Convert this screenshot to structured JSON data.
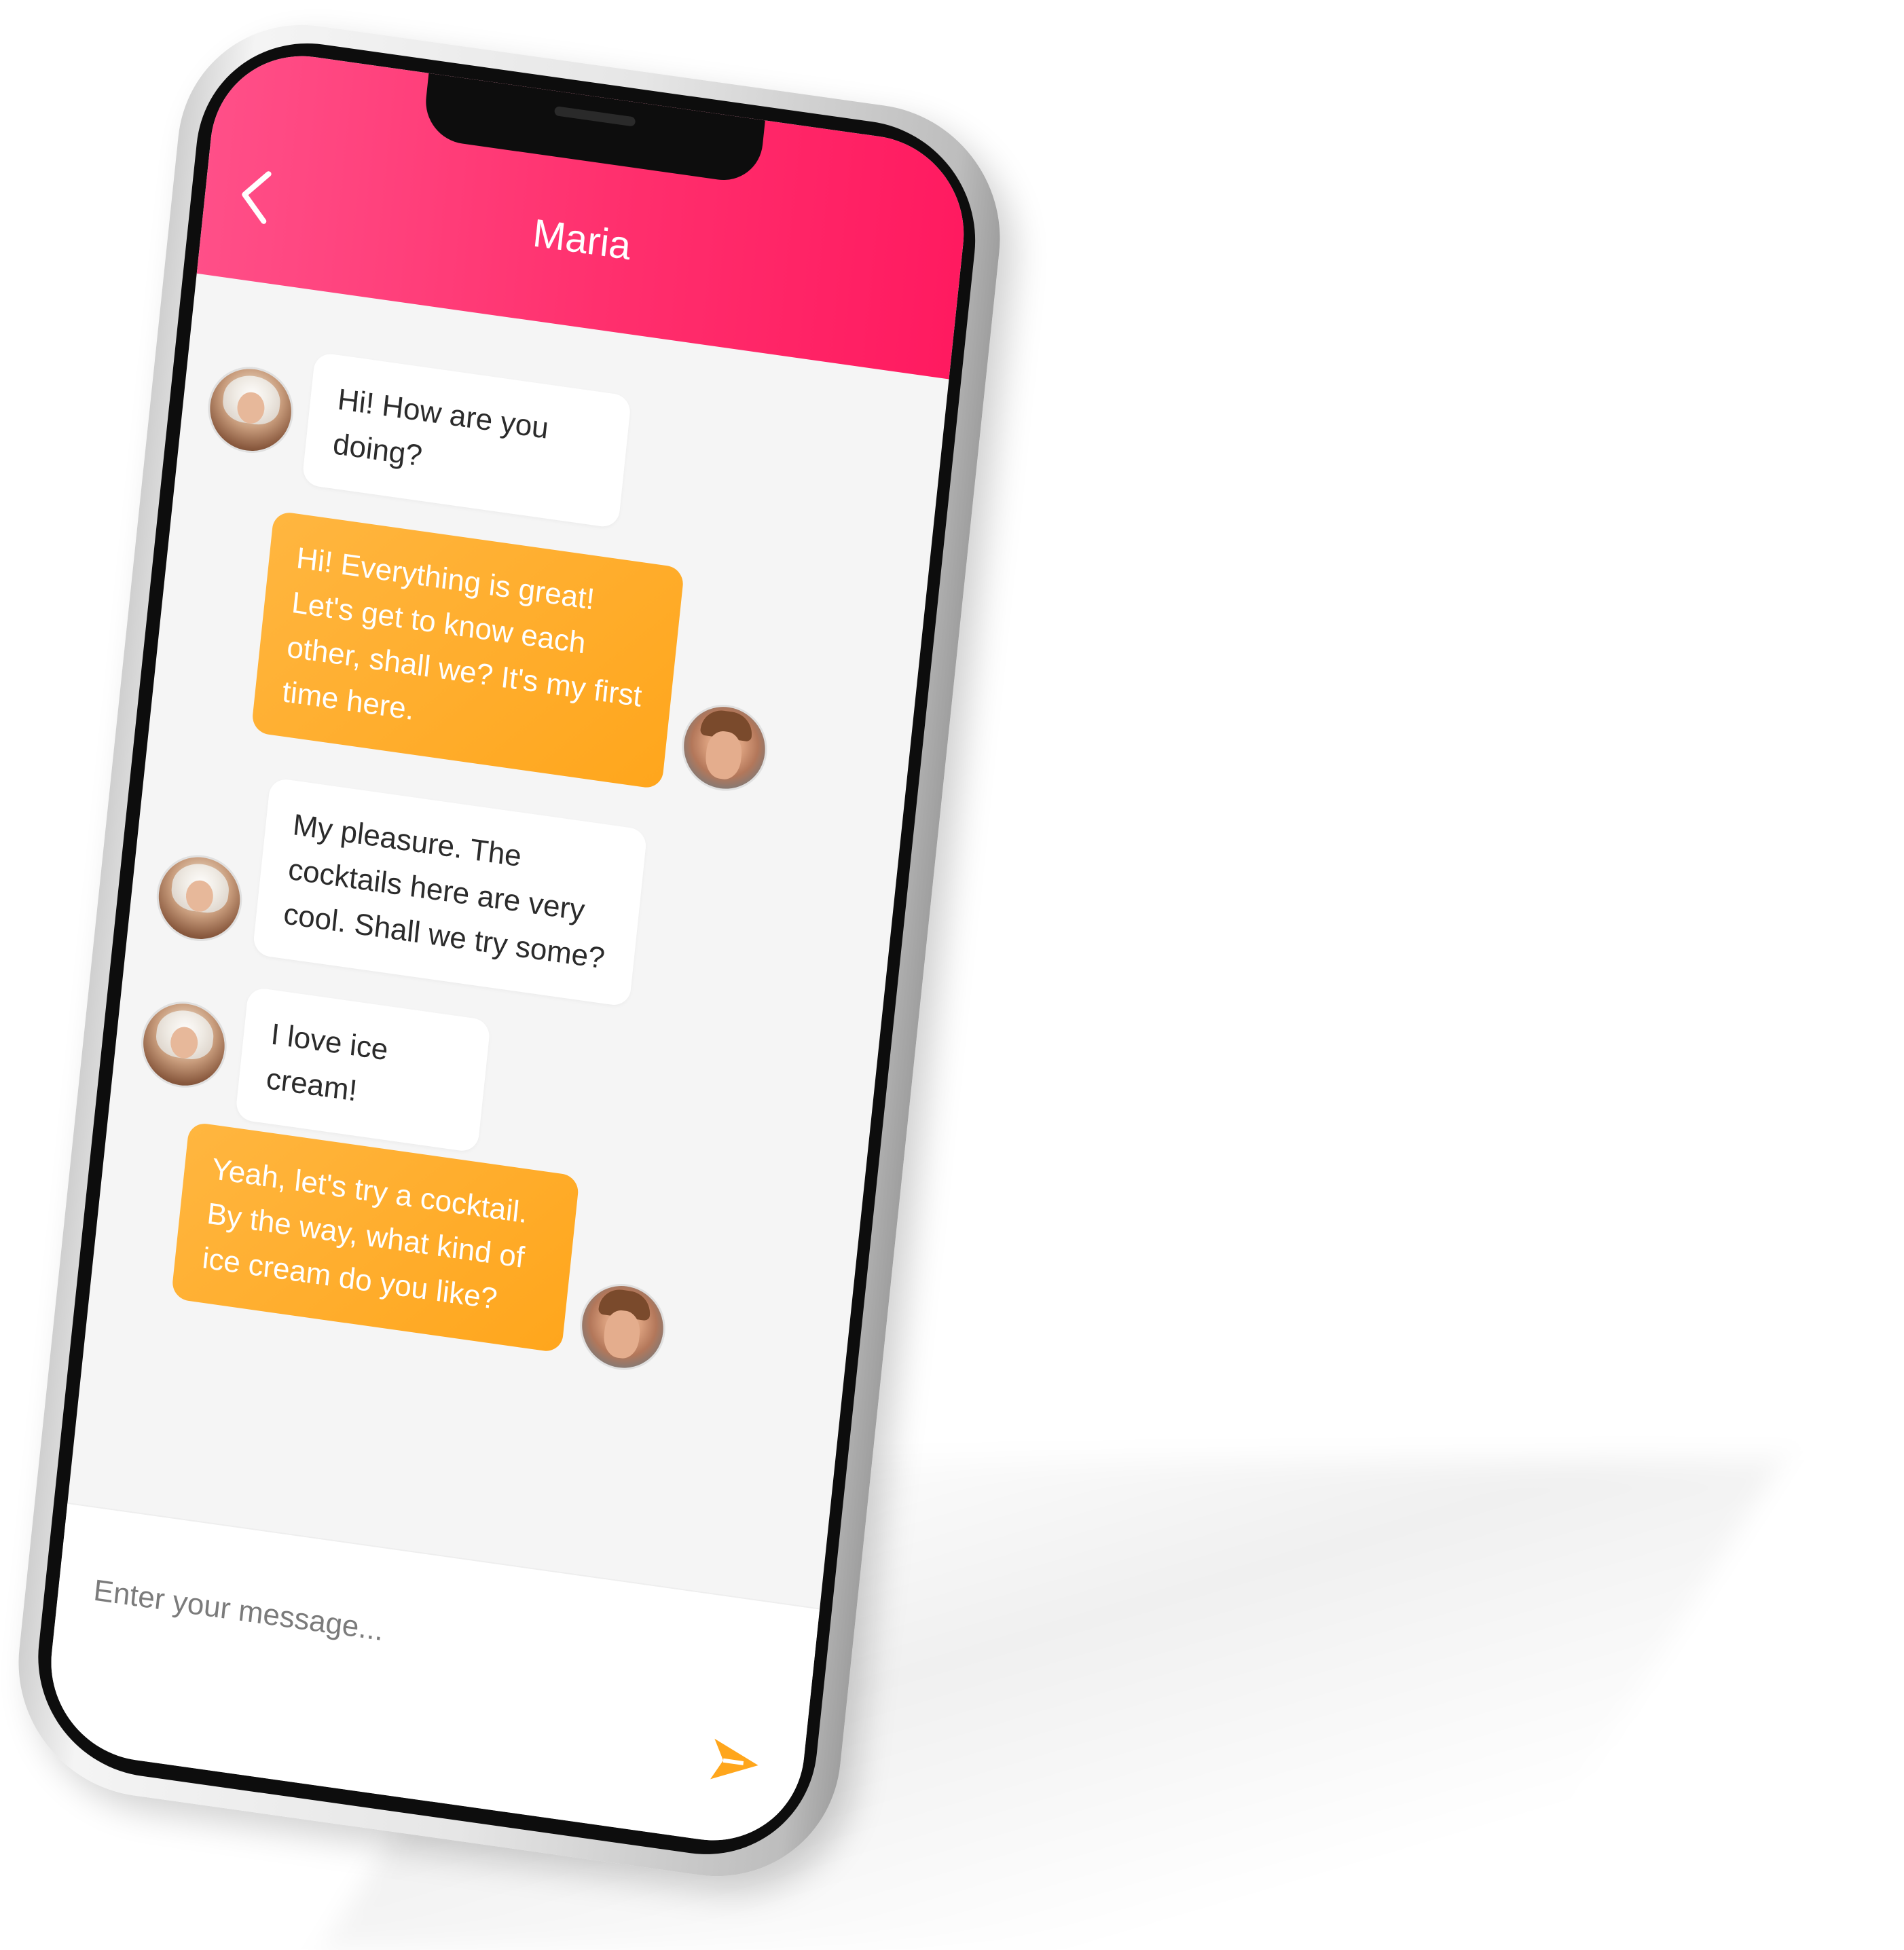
{
  "header": {
    "title": "Maria",
    "back_icon": "chevron-left-icon"
  },
  "colors": {
    "header_start": "#ff4f88",
    "header_end": "#ff1a60",
    "outgoing_bubble": "#ffa61c",
    "incoming_bubble": "#ffffff",
    "send_icon": "#ffa61c"
  },
  "messages": [
    {
      "sender": "Maria",
      "direction": "incoming",
      "text": "Hi! How are you doing?"
    },
    {
      "sender": "me",
      "direction": "outgoing",
      "text": "Hi! Everything is great! Let's get to know each other, shall we? It's my first time here."
    },
    {
      "sender": "Maria",
      "direction": "incoming",
      "text": "My pleasure. The cocktails here are very cool. Shall we try some?"
    },
    {
      "sender": "Maria",
      "direction": "incoming",
      "text": "I love ice cream!"
    },
    {
      "sender": "me",
      "direction": "outgoing",
      "text": "Yeah, let's try a cocktail. By the way, what kind of ice cream do you like?"
    }
  ],
  "composer": {
    "value": "",
    "placeholder": "Enter your message...",
    "send_icon": "send-arrow-icon"
  }
}
